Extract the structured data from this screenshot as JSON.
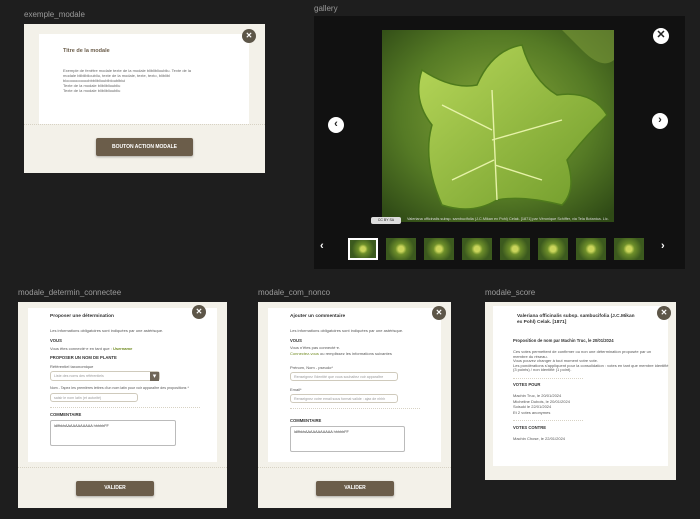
{
  "frames": {
    "exemple_modale": "exemple_modale",
    "gallery": "gallery",
    "determin": "modale_determin_connectee",
    "com": "modale_com_nonco",
    "score": "modale_score"
  },
  "exemple": {
    "title": "Titre de la modale",
    "body_lines": [
      "Exemple de fenêtre modale texte de la modale blibliblioubliu. Texte de la",
      "modale blibliblioubliu, texte de la modale, texte, texto, bliblibl",
      "bloooooooooobbbliblioublbloublbiui",
      "Texte de la modale blibliblioubliu",
      "Texte de la modale blibliblioubliu"
    ],
    "action_label": "BOUTON ACTION MODALE",
    "close_glyph": "✕"
  },
  "gallery": {
    "caption": "Valeriana officinalis subsp. sambucifolia (J.C.Mikan ex Pohl) Celak. [1871] par Véronique Schiffer, via Tela Botanica. Lic.",
    "close_glyph": "✕",
    "prev_glyph": "‹",
    "next_glyph": "›",
    "thumb_next_glyph": "›",
    "license": "CC BY SA"
  },
  "determin": {
    "title": "Proposer une détermination",
    "required_note": "Les informations obligatoires sont indiquées par une astérisque.",
    "vous_heading": "VOUS",
    "connected_prefix": "Vous êtes connecté·e en tant que :",
    "username": "Username",
    "plant_heading": "PROPOSER UN NOM DE PLANTE",
    "ref_label": "Référentiel taxonomique",
    "ref_value": "Liste des noms des référentiels",
    "name_label": "Nom - Tapez les premières lettres d'un nom latin pour voir apparaître des propositions *",
    "name_placeholder": "saisir le nom latin (et autorité)",
    "comment_heading": "COMMENTAIRE",
    "comment_value": "ldlfhkhAAAAAAAAAAA hhhhhFF",
    "submit_label": "VALIDER",
    "close_glyph": "✕",
    "chevron": "▾"
  },
  "com": {
    "title": "Ajouter un commentaire",
    "required_note": "Les informations obligatoires sont indiquées par une astérisque.",
    "vous_heading": "VOUS",
    "not_connected": "Vous n'êtes pas connecté·e.",
    "connect_link": "Connectez-vous",
    "connect_suffix": "ou remplissez les informations suivantes",
    "name_label": "Prénom, Nom - pseudo*",
    "name_placeholder": "Renseignez l'identité que vous souhaitez voir apparaître",
    "email_label": "Email*",
    "email_placeholder": "Renseignez votre email sous format valide : ajax de nhhh",
    "comment_heading": "COMMENTAIRE",
    "comment_value": "ldlfhkhAAAAAAAAAAA hhhhhFF",
    "submit_label": "VALIDER",
    "close_glyph": "✕"
  },
  "score": {
    "title": "Valeriana officinalis subsp. sambucifolia (J.C.Mikan ex Pohl) Celak. [1871]",
    "proposal": "Proposition de nom par Machin Truc, le 20/01/2024",
    "info_lines": [
      "Ces votes permettent de confirmer ou non une détermination proposée par un",
      "membre du réseau.",
      "Vous pouvez changer à tout moment votre vote.",
      "Les pondérations s'appliquent pour la consolidation : votes en tant que membre identifié",
      "(3 points) / non identifié (1 point)."
    ],
    "for_heading": "VOTES POUR",
    "for_votes": [
      "Machin Truc, le 20/01/2024",
      "Micheline Dubois, le 20/01/2024",
      "Soisuki le 22/01/2024",
      "Et 2 votes anonymes"
    ],
    "against_heading": "VOTES CONTRE",
    "against_votes": [
      "Machin Chose, le 22/01/2024"
    ],
    "close_glyph": "✕"
  }
}
